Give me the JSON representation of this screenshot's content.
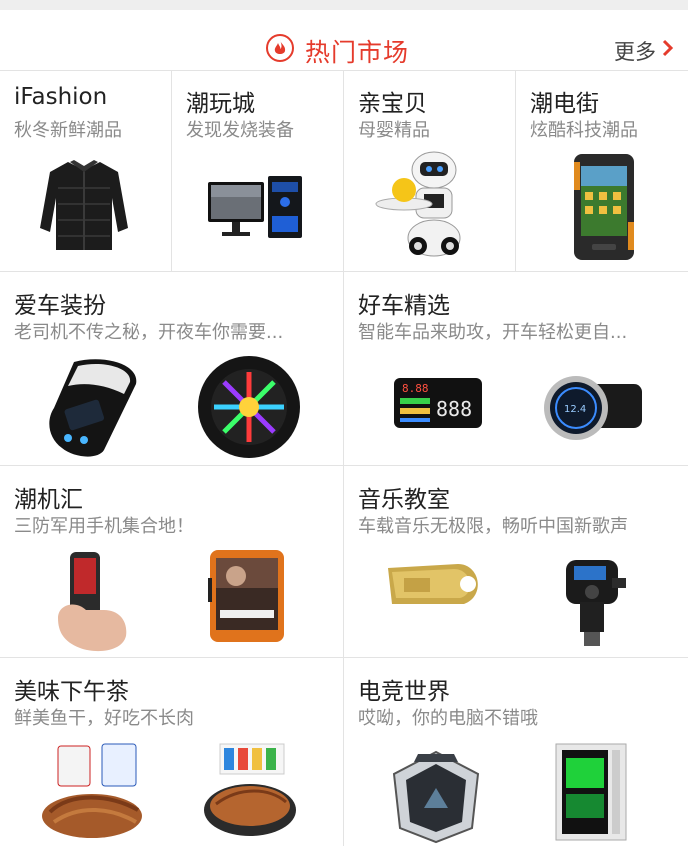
{
  "header": {
    "title": "热门市场",
    "more_label": "更多",
    "icon": "fire-icon",
    "accent": "#e53b2c"
  },
  "row1": [
    {
      "title": "iFashion",
      "subtitle": "秋冬新鲜潮品",
      "product": "puffer-jacket"
    },
    {
      "title": "潮玩城",
      "subtitle": "发现发烧装备",
      "product": "pc-monitor-tower"
    },
    {
      "title": "亲宝贝",
      "subtitle": "母婴精品",
      "product": "toy-robot"
    },
    {
      "title": "潮电街",
      "subtitle": "炫酷科技潮品",
      "product": "rugged-phone"
    }
  ],
  "row2": [
    {
      "title": "爱车装扮",
      "subtitle": "老司机不传之秘，开夜车你需要...",
      "products": [
        "car-remote",
        "led-wheel"
      ]
    },
    {
      "title": "好车精选",
      "subtitle": "智能车品来助攻，开车轻松更自...",
      "products": [
        "hud-display",
        "car-charger"
      ]
    }
  ],
  "row3": [
    {
      "title": "潮机汇",
      "subtitle": "三防军用手机集合地！",
      "products": [
        "rugged-phone-hand",
        "rugged-phone-orange"
      ]
    },
    {
      "title": "音乐教室",
      "subtitle": "车载音乐无极限，畅听中国新歌声",
      "products": [
        "usb-drive",
        "fm-transmitter"
      ]
    }
  ],
  "row4": [
    {
      "title": "美味下午茶",
      "subtitle": "鲜美鱼干，好吃不长肉",
      "products": [
        "dried-fish-packs",
        "dried-fish-plate"
      ]
    },
    {
      "title": "电竞世界",
      "subtitle": "哎呦，你的电脑不错哦",
      "products": [
        "gaming-pc-hex",
        "gaming-pc-tower"
      ]
    }
  ]
}
